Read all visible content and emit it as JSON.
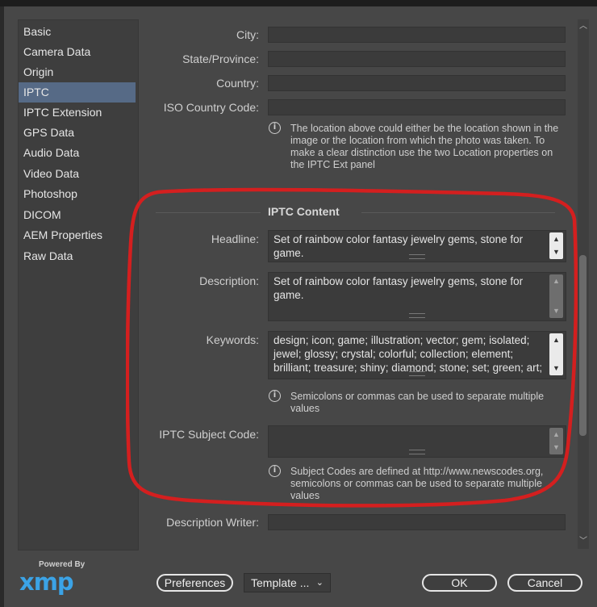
{
  "sidebar": {
    "items": [
      {
        "label": "Basic"
      },
      {
        "label": "Camera Data"
      },
      {
        "label": "Origin"
      },
      {
        "label": "IPTC"
      },
      {
        "label": "IPTC Extension"
      },
      {
        "label": "GPS Data"
      },
      {
        "label": "Audio Data"
      },
      {
        "label": "Video Data"
      },
      {
        "label": "Photoshop"
      },
      {
        "label": "DICOM"
      },
      {
        "label": "AEM Properties"
      },
      {
        "label": "Raw Data"
      }
    ],
    "selected": "IPTC"
  },
  "location_fields": {
    "city": {
      "label": "City:",
      "value": ""
    },
    "state": {
      "label": "State/Province:",
      "value": ""
    },
    "country": {
      "label": "Country:",
      "value": ""
    },
    "iso": {
      "label": "ISO Country Code:",
      "value": ""
    },
    "note": "The location above could either be the location shown in the image or the location from which the photo was taken. To make a clear distinction use the two Location properties on the IPTC Ext panel"
  },
  "iptc_content": {
    "title": "IPTC Content",
    "headline": {
      "label": "Headline:",
      "value": "Set of rainbow color fantasy jewelry gems, stone for game."
    },
    "description": {
      "label": "Description:",
      "value": "Set of rainbow color fantasy jewelry gems, stone for game."
    },
    "keywords": {
      "label": "Keywords:",
      "value": "design; icon; game; illustration; vector; gem; isolated; jewel; glossy; crystal; colorful; collection; element; brilliant; treasure; shiny; diamond; stone; set; green; art;"
    },
    "keywords_note": "Semicolons or commas can be used to separate multiple values",
    "subject_code": {
      "label": "IPTC Subject Code:",
      "value": ""
    },
    "subject_note": "Subject Codes are defined at http://www.newscodes.org, semicolons or commas can be used to separate multiple values",
    "description_writer": {
      "label": "Description Writer:",
      "value": ""
    }
  },
  "footer": {
    "powered_by": "Powered By",
    "logo": "xmp",
    "preferences": "Preferences",
    "template": "Template ...",
    "ok": "OK",
    "cancel": "Cancel"
  },
  "colors": {
    "background": "#474747",
    "selected_item": "#566a86",
    "annotation": "#d41f1f",
    "xmp_logo": "#3ba3e6"
  }
}
